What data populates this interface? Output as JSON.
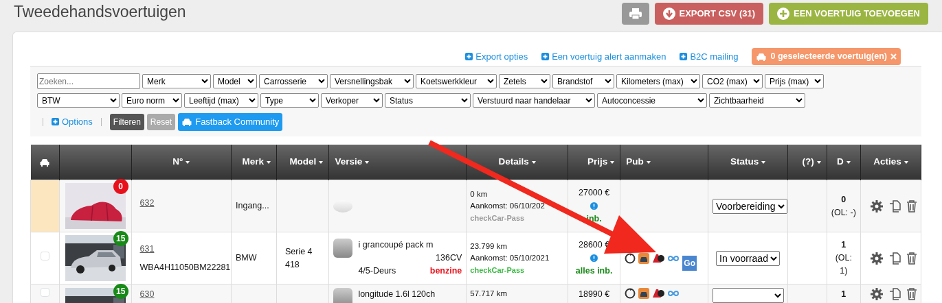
{
  "page_title": "Tweedehandsvoertuigen",
  "top_buttons": [
    {
      "kind": "print"
    },
    {
      "kind": "export",
      "label": "EXPORT CSV (31)"
    },
    {
      "kind": "add",
      "label": "EEN VOERTUIG TOEVOEGEN"
    }
  ],
  "card_links": [
    {
      "label": "Export opties"
    },
    {
      "label": "Een voertuig alert aanmaken"
    },
    {
      "label": "B2C mailing"
    }
  ],
  "selection_badge": "0 geselecteerde voertuig(en)",
  "search": {
    "placeholder": "Zoeken..."
  },
  "filter_rows": [
    [
      "Merk",
      "Model",
      "Carrosserie",
      "Versnellingsbak",
      "Koetswerkkleur",
      "Zetels",
      "Brandstof",
      "Kilometers (max)",
      "CO2 (max)",
      "Prijs (max)"
    ],
    [
      "BTW",
      "Euro norm",
      "Leeftijd (max)",
      "Type",
      "Verkoper",
      "Status",
      "Verstuurd naar handelaar",
      "Autoconcessie",
      "Zichtbaarheid"
    ]
  ],
  "filter_actions": {
    "options": "Options",
    "filter": "Filteren",
    "reset": "Reset",
    "community": "Fastback Community"
  },
  "table": {
    "columns": [
      "N°",
      "Merk",
      "Model",
      "Versie",
      "Details",
      "Prijs",
      "Pub",
      "Status",
      "(?)",
      "D",
      "Acties"
    ],
    "rows": [
      {
        "marked": true,
        "photo": {
          "kind": "picture"
        },
        "photo_count": "0",
        "color": "#e8111b",
        "number": "632",
        "vin": "",
        "merk": "Ingang...",
        "model": [],
        "version": null,
        "details": [
          "0 km",
          "Aankomst: 06/10/202"
        ],
        "carpass": {
          "text": "checkCar-Pass",
          "verified": false
        },
        "price": "27000 €",
        "price_note": "inb.",
        "pub": [],
        "status": "Voorbereiding",
        "d": "0",
        "ol": "(OL: -)"
      },
      {
        "marked": false,
        "checked": false,
        "photo": {
          "kind": "picture"
        },
        "photo_count": "15",
        "color": "#178a17",
        "number": "631",
        "vin": "WBA4H11050BM22281",
        "merk": "BMW",
        "model": [
          "Serie 4",
          "418"
        ],
        "version": {
          "title": "i grancoupé pack m",
          "power": "136CV",
          "doors": "4/5-Deurs",
          "fuel": "benzine"
        },
        "details": [
          "23.799 km",
          "Aankomst: 05/10/2021"
        ],
        "carpass": {
          "text": "checkCar-Pass",
          "verified": true
        },
        "price": "28600 €",
        "price_note": "alles inb.",
        "pub": [
          {
            "kind": "refresh"
          },
          {
            "kind": "car"
          },
          {
            "kind": "logo"
          },
          {
            "kind": "infinity"
          },
          {
            "kind": "go",
            "label": "Go"
          }
        ],
        "status": "In voorraad",
        "d": "1",
        "ol": "(OL: 1)"
      },
      {
        "marked": false,
        "checked": false,
        "photo": {
          "kind": "picture"
        },
        "photo_count": "15",
        "color": "#178a17",
        "number": "630",
        "vin": "",
        "merk": "",
        "model": [],
        "version": {
          "title": "longitude 1.6l 120ch"
        },
        "details": [
          "57.717 km"
        ],
        "price": "18990 €",
        "pub": [
          {
            "kind": "refresh"
          },
          {
            "kind": "car"
          },
          {
            "kind": "logo"
          },
          {
            "kind": "infinity"
          }
        ],
        "status": "",
        "d": "1"
      }
    ]
  },
  "annotation": {
    "kind": "arrow"
  }
}
